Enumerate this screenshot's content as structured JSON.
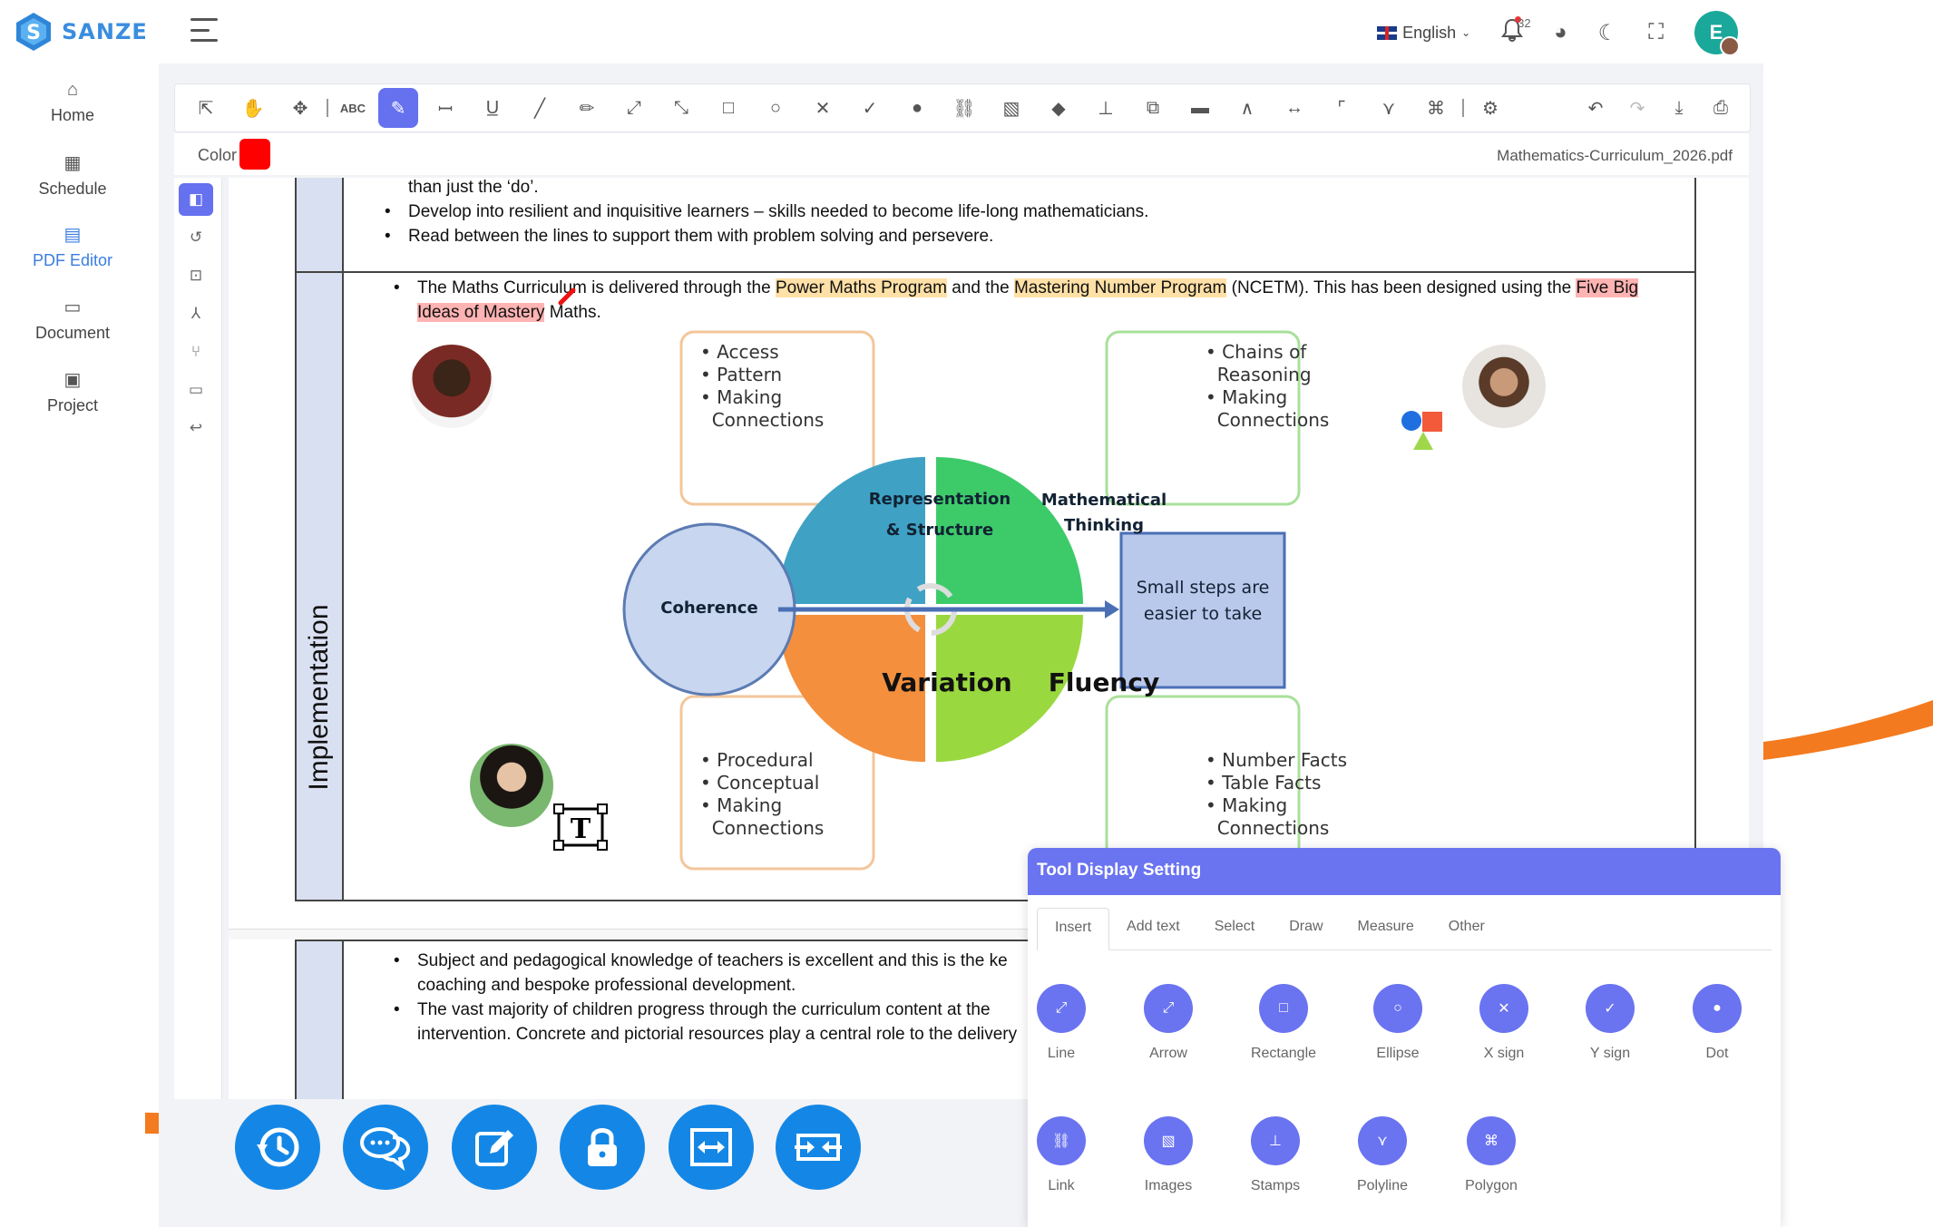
{
  "app": {
    "brand": "SANZE",
    "language": "English",
    "notification_count": "32",
    "user_initial": "E"
  },
  "sidebar": {
    "items": [
      {
        "label": "Home",
        "icon": "home-icon"
      },
      {
        "label": "Schedule",
        "icon": "calendar-icon"
      },
      {
        "label": "PDF Editor",
        "icon": "pdf-icon"
      },
      {
        "label": "Document",
        "icon": "folder-icon"
      },
      {
        "label": "Project",
        "icon": "briefcase-icon"
      }
    ]
  },
  "toolbar": {
    "abc_label": "ABC",
    "color_label": "Color",
    "color_value": "#ff0000",
    "file_name": "Mathematics-Curriculum_2026.pdf"
  },
  "document": {
    "line_top_1": "than just the ‘do’.",
    "bullet_1": "Develop into resilient and inquisitive learners – skills needed to become life-long mathematicians.",
    "bullet_2": "Read between the lines to support them with problem solving and persevere.",
    "impl_a": "The Maths Curriculum is delivered through the ",
    "impl_h1": "Power Maths Program",
    "impl_b": " and the ",
    "impl_h2": "Mastering Number Program",
    "impl_c": " (NCETM). This has been designed using the ",
    "impl_h3a": "Five Big",
    "impl_h3b": "Ideas of Mastery",
    "impl_d": " Maths.",
    "side_label": "Implementation",
    "diagram": {
      "tl_box": [
        "Access",
        "Pattern",
        "Making",
        "Connections"
      ],
      "tr_box": [
        "Chains of",
        "Reasoning",
        "Making",
        "Connections"
      ],
      "bl_box": [
        "Procedural",
        "Conceptual",
        "Making",
        "Connections"
      ],
      "br_box": [
        "Number Facts",
        "Table Facts",
        "Making",
        "Connections"
      ],
      "q_tl_1": "Representation",
      "q_tl_2": "& Structure",
      "q_tr_1": "Mathematical",
      "q_tr_2": "Thinking",
      "q_bl": "Variation",
      "q_br": "Fluency",
      "coherence": "Coherence",
      "small_steps_1": "Small steps are",
      "small_steps_2": "easier to take",
      "colors": {
        "tl": "#3fa2c4",
        "tr": "#3dcb6a",
        "bl": "#f48f3d",
        "br": "#9ad83f",
        "coherence": "#c8d6ef",
        "steps": "#b9c9ec"
      }
    },
    "p2_bullet_1a": "Subject and pedagogical knowledge of teachers is excellent and this is the ke",
    "p2_bullet_1b": "coaching and bespoke professional development.",
    "p2_bullet_2a": "The vast majority of children progress through the curriculum content at the",
    "p2_bullet_2b": "intervention. Concrete and pictorial resources play a central role to the delivery"
  },
  "tool_panel": {
    "title": "Tool Display Setting",
    "tabs": [
      "Insert",
      "Add text",
      "Select",
      "Draw",
      "Measure",
      "Other"
    ],
    "tools_row1": [
      "Line",
      "Arrow",
      "Rectangle",
      "Ellipse",
      "X sign",
      "Y sign",
      "Dot"
    ],
    "tools_row2": [
      "Link",
      "Images",
      "Stamps",
      "Polyline",
      "Polygon"
    ]
  }
}
